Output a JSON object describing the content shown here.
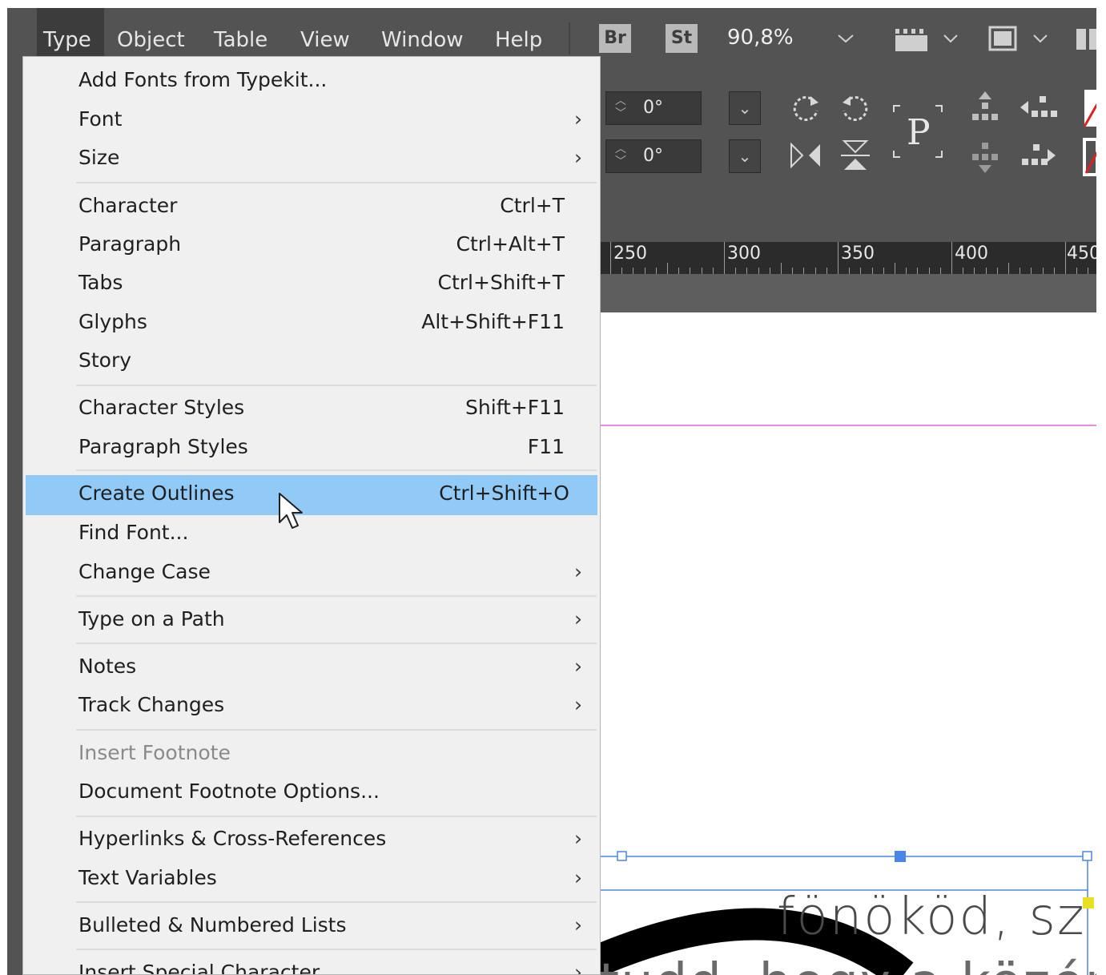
{
  "menubar": {
    "items": [
      {
        "label": "Type",
        "active": true
      },
      {
        "label": "Object"
      },
      {
        "label": "Table"
      },
      {
        "label": "View"
      },
      {
        "label": "Window"
      },
      {
        "label": "Help"
      }
    ],
    "bridge_badge": "Br",
    "stock_badge": "St",
    "zoom": "90,8%"
  },
  "control_panel": {
    "rotation_value": "0°",
    "shear_value": "0°"
  },
  "ruler": {
    "labels": [
      "250",
      "300",
      "350",
      "400",
      "450"
    ]
  },
  "type_menu": {
    "items": [
      {
        "label": "Add Fonts from Typekit...",
        "shortcut": "",
        "submenu": false
      },
      {
        "label": "Font",
        "shortcut": "",
        "submenu": true
      },
      {
        "label": "Size",
        "shortcut": "",
        "submenu": true
      },
      {
        "label": "Character",
        "shortcut": "Ctrl+T",
        "submenu": false
      },
      {
        "label": "Paragraph",
        "shortcut": "Ctrl+Alt+T",
        "submenu": false
      },
      {
        "label": "Tabs",
        "shortcut": "Ctrl+Shift+T",
        "submenu": false
      },
      {
        "label": "Glyphs",
        "shortcut": "Alt+Shift+F11",
        "submenu": false
      },
      {
        "label": "Story",
        "shortcut": "",
        "submenu": false
      },
      {
        "label": "Character Styles",
        "shortcut": "Shift+F11",
        "submenu": false
      },
      {
        "label": "Paragraph Styles",
        "shortcut": "F11",
        "submenu": false
      },
      {
        "label": "Create Outlines",
        "shortcut": "Ctrl+Shift+O",
        "submenu": false,
        "highlighted": true
      },
      {
        "label": "Find Font...",
        "shortcut": "",
        "submenu": false
      },
      {
        "label": "Change Case",
        "shortcut": "",
        "submenu": true
      },
      {
        "label": "Type on a Path",
        "shortcut": "",
        "submenu": true
      },
      {
        "label": "Notes",
        "shortcut": "",
        "submenu": true
      },
      {
        "label": "Track Changes",
        "shortcut": "",
        "submenu": true
      },
      {
        "label": "Insert Footnote",
        "shortcut": "",
        "submenu": false,
        "disabled": true
      },
      {
        "label": "Document Footnote Options...",
        "shortcut": "",
        "submenu": false
      },
      {
        "label": "Hyperlinks & Cross-References",
        "shortcut": "",
        "submenu": true
      },
      {
        "label": "Text Variables",
        "shortcut": "",
        "submenu": true
      },
      {
        "label": "Bulleted & Numbered Lists",
        "shortcut": "",
        "submenu": true
      },
      {
        "label": "Insert Special Character",
        "shortcut": "",
        "submenu": true
      }
    ]
  },
  "document": {
    "text_line1": "fönököd, sz",
    "text_line2": "tudd, hogy a közép"
  },
  "colors": {
    "menubar": "#535353",
    "menu_bg": "#f0f0f0",
    "highlight": "#91c9f7",
    "guide_magenta": "#e88be8",
    "frame_blue": "#4a86e8"
  }
}
